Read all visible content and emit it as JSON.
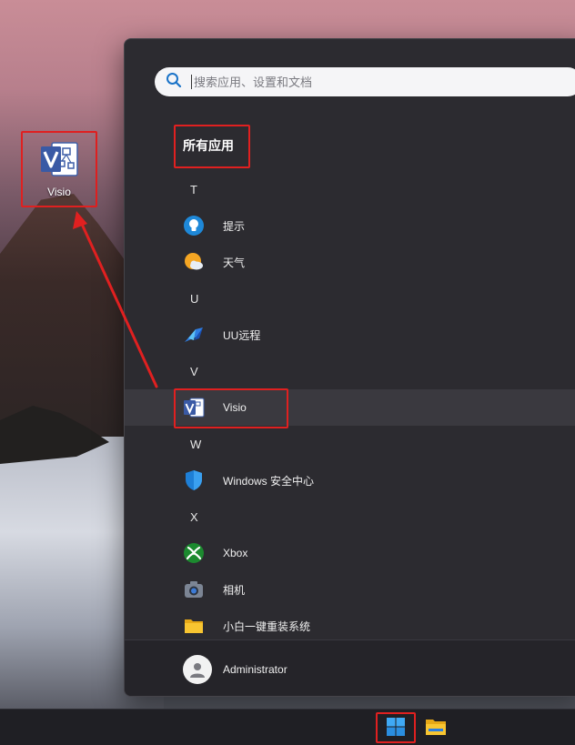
{
  "desktop": {
    "icon_label": "Visio"
  },
  "start_menu": {
    "search": {
      "placeholder": "搜索应用、设置和文档"
    },
    "section_title": "所有应用",
    "items": [
      {
        "kind": "letter",
        "label": "T"
      },
      {
        "kind": "app",
        "label": "提示",
        "icon": "tips-icon"
      },
      {
        "kind": "app",
        "label": "天气",
        "icon": "weather-icon"
      },
      {
        "kind": "letter",
        "label": "U"
      },
      {
        "kind": "app",
        "label": "UU远程",
        "icon": "uu-remote-icon"
      },
      {
        "kind": "letter",
        "label": "V"
      },
      {
        "kind": "app",
        "label": "Visio",
        "icon": "visio-icon",
        "selected": true
      },
      {
        "kind": "letter",
        "label": "W"
      },
      {
        "kind": "app",
        "label": "Windows 安全中心",
        "icon": "windows-security-icon"
      },
      {
        "kind": "letter",
        "label": "X"
      },
      {
        "kind": "app",
        "label": "Xbox",
        "icon": "xbox-icon"
      },
      {
        "kind": "app",
        "label": "相机",
        "icon": "camera-icon"
      },
      {
        "kind": "app",
        "label": "小白一键重装系统",
        "icon": "folder-icon"
      }
    ],
    "user": {
      "name": "Administrator"
    }
  },
  "colors": {
    "highlight": "#e02020",
    "menu_bg": "#2c2b30",
    "accent": "#2b579a"
  }
}
